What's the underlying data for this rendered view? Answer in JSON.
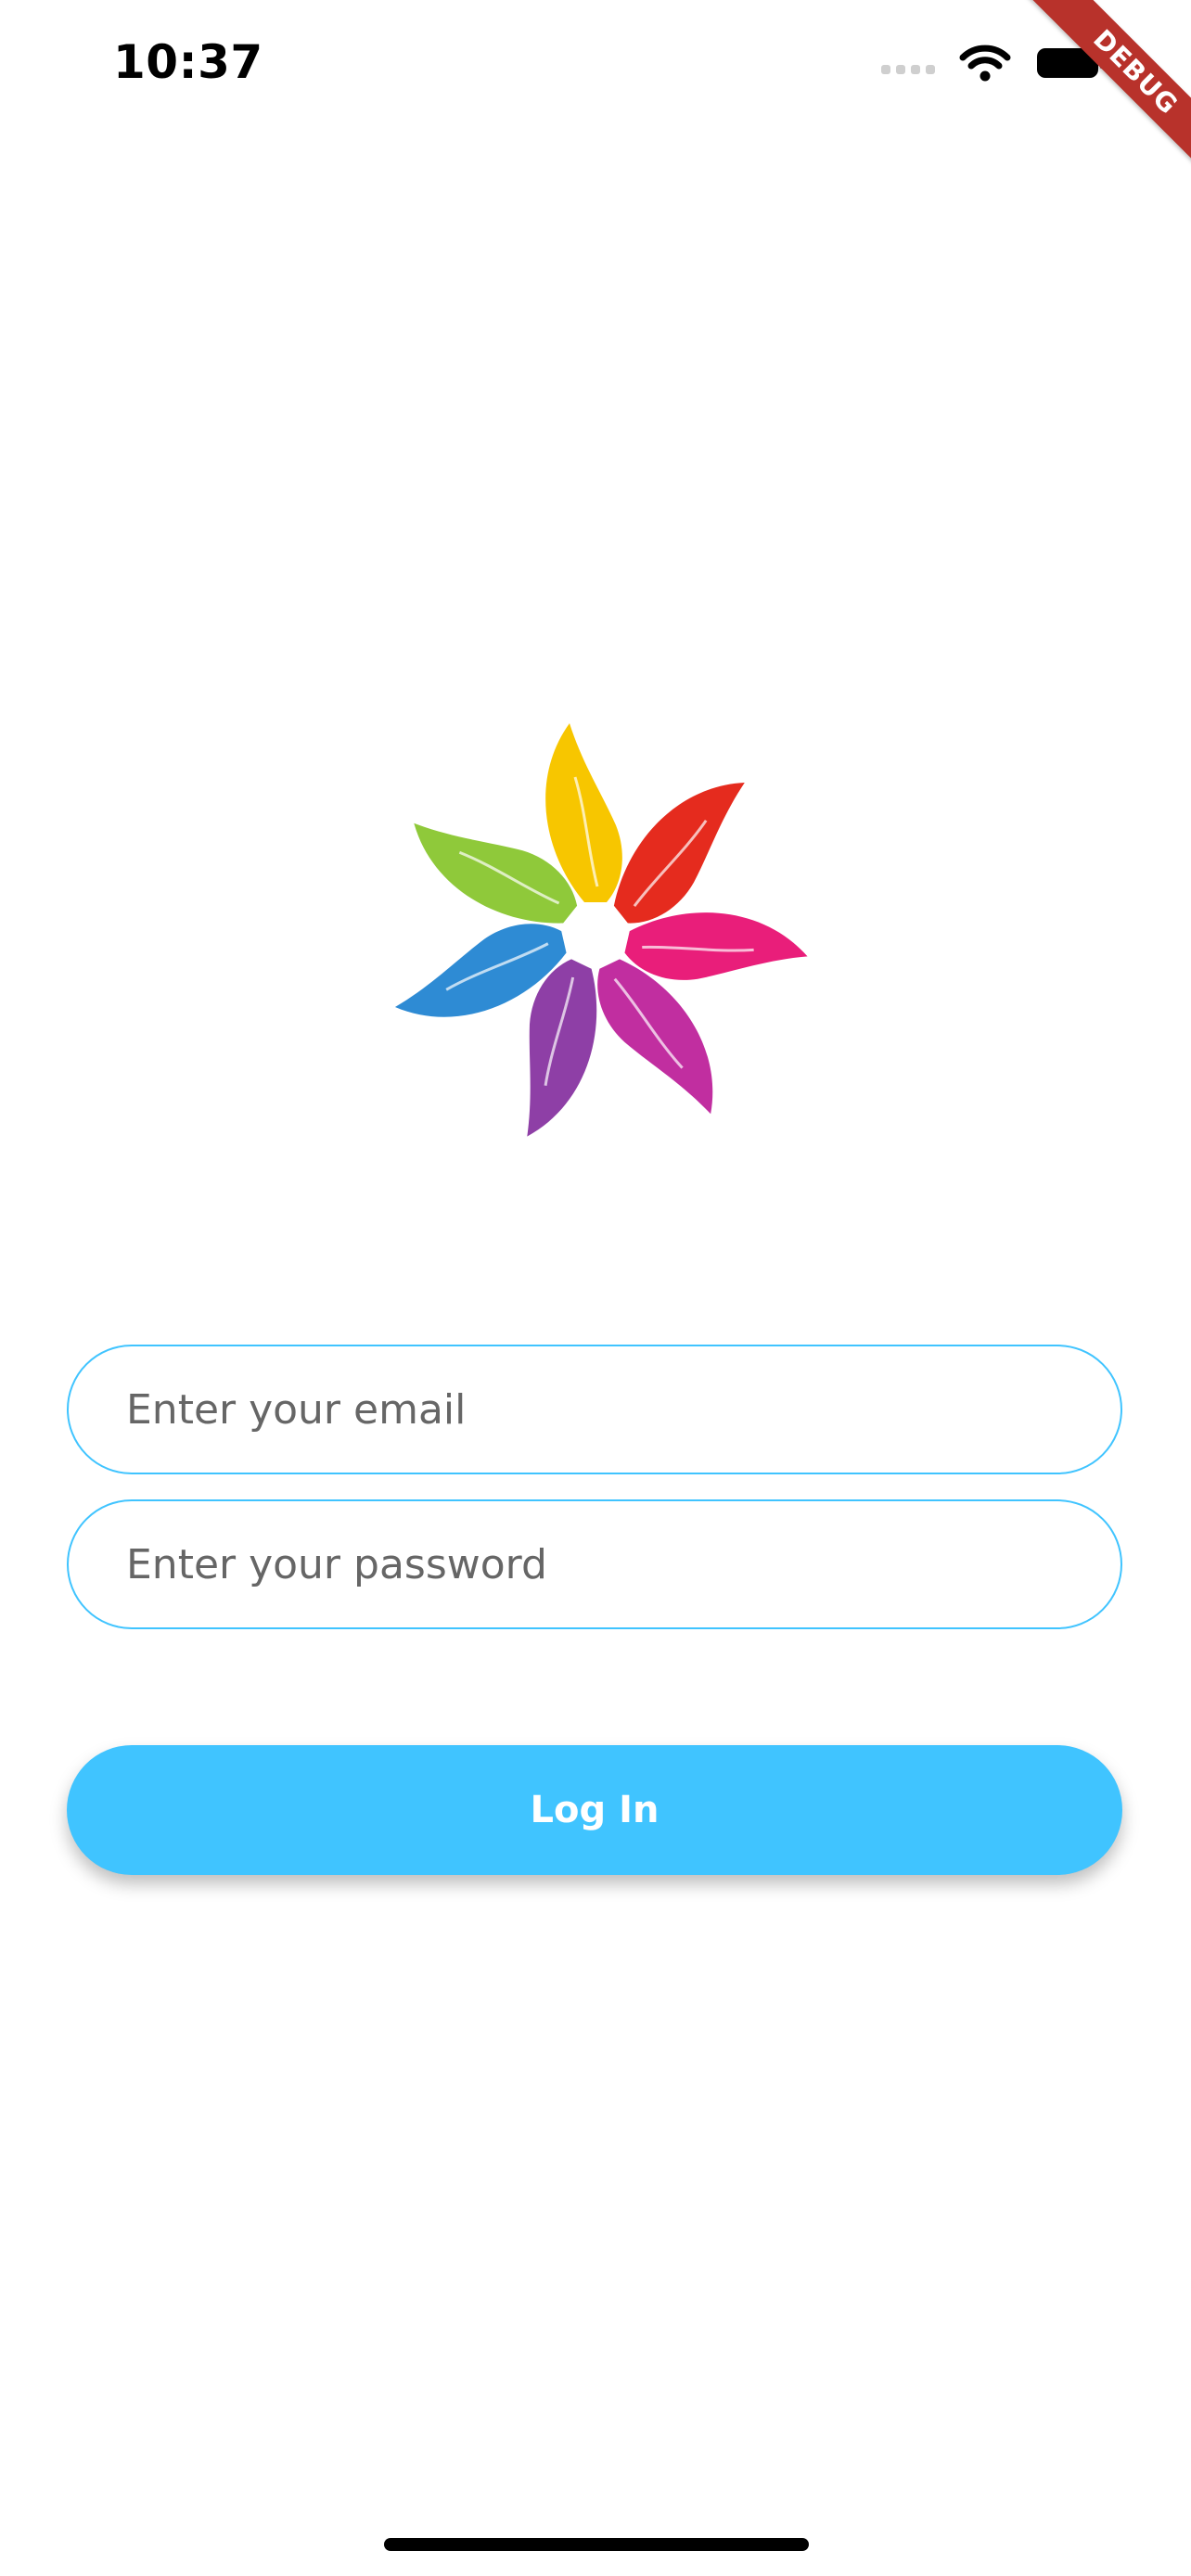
{
  "status_bar": {
    "time": "10:37",
    "icons": [
      "signal-icon",
      "wifi-icon",
      "battery-icon"
    ]
  },
  "debug_banner": {
    "label": "DEBUG"
  },
  "logo": {
    "icon": "hands-circle-logo",
    "colors": [
      "#f7c600",
      "#e52b1e",
      "#e91e7a",
      "#c12ea0",
      "#8e3fa6",
      "#2e8bd4",
      "#8fc93a"
    ]
  },
  "login_form": {
    "email": {
      "placeholder": "Enter your email",
      "value": ""
    },
    "password": {
      "placeholder": "Enter your password",
      "value": ""
    },
    "login_label": "Log In"
  },
  "colors": {
    "accent": "#40c4ff",
    "background": "#ffffff",
    "debug_banner": "#b8322b"
  }
}
